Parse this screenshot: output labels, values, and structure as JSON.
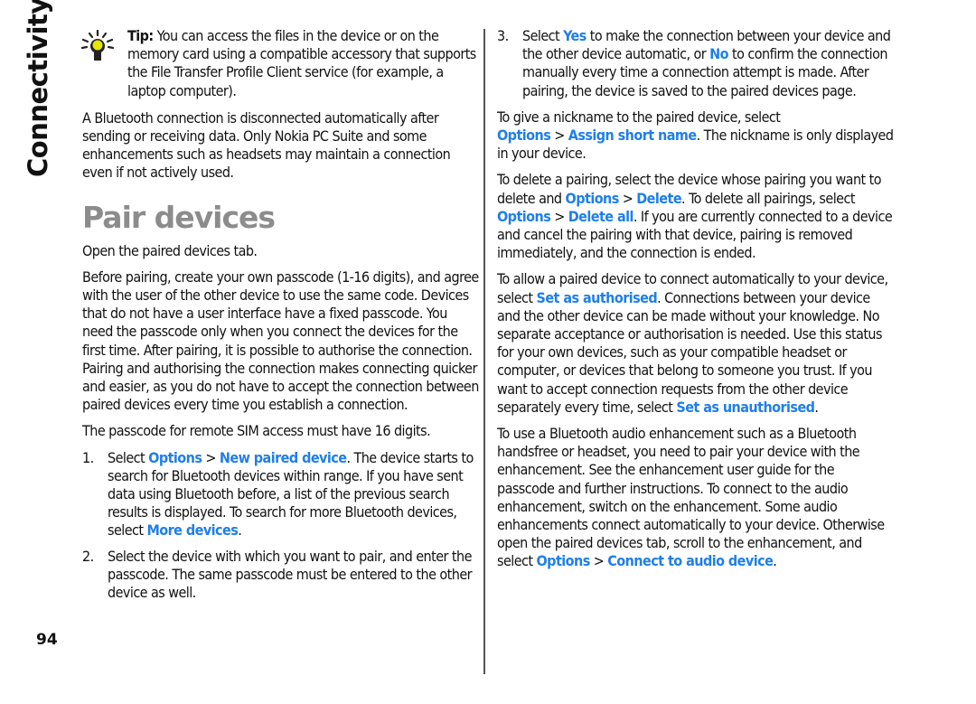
{
  "section_title": "Connectivity",
  "page_number": "94",
  "colors": {
    "link": "#1f7fe8",
    "heading": "#8c8c8c",
    "text": "#111111"
  },
  "left": {
    "tip": {
      "icon": "lightbulb-icon",
      "label": "Tip:",
      "text": " You can access the files in the device or on the memory card using a compatible accessory that supports the File Transfer Profile Client service (for example, a laptop computer)."
    },
    "para_disconnect": "A Bluetooth connection is disconnected automatically after sending or receiving data. Only Nokia PC Suite and some enhancements such as headsets may maintain a connection even if not actively used.",
    "heading": "Pair devices",
    "para_open": "Open the paired devices tab.",
    "para_before": "Before pairing, create your own passcode (1-16 digits), and agree with the user of the other device to use the same code. Devices that do not have a user interface have a fixed passcode. You need the passcode only when you connect the devices for the first time. After pairing, it is possible to authorise the connection. Pairing and authorising the connection makes connecting quicker and easier, as you do not have to accept the connection between paired devices every time you establish a connection.",
    "para_sim": "The passcode for remote SIM access must have 16 digits.",
    "steps": [
      {
        "num": "1.",
        "pre": "Select ",
        "link1": "Options",
        "sep": ">",
        "link2": "New paired device",
        "mid": ". The device starts to search for Bluetooth devices within range. If you have sent data using Bluetooth before, a list of the previous search results is displayed. To search for more Bluetooth devices, select ",
        "link3": "More devices",
        "post": "."
      },
      {
        "num": "2.",
        "text": "Select the device with which you want to pair, and enter the passcode. The same passcode must be entered to the other device as well."
      }
    ]
  },
  "right": {
    "step3": {
      "num": "3.",
      "pre": "Select ",
      "link_yes": "Yes",
      "mid": " to make the connection between your device and the other device automatic, or ",
      "link_no": "No",
      "post": " to confirm the connection manually every time a connection attempt is made. After pairing, the device is saved to the paired devices page."
    },
    "nickname": {
      "pre": "To give a nickname to the paired device, select ",
      "link1": "Options",
      "sep": ">",
      "link2": "Assign short name",
      "post": ". The nickname is only displayed in your device."
    },
    "delete": {
      "pre": "To delete a pairing, select the device whose pairing you want to delete and ",
      "link1": "Options",
      "sep1": ">",
      "link2": "Delete",
      "mid": ". To delete all pairings, select ",
      "link3": "Options",
      "sep2": ">",
      "link4": "Delete all",
      "post": ". If you are currently connected to a device and cancel the pairing with that device, pairing is removed immediately, and the connection is ended."
    },
    "authorise": {
      "pre": "To allow a paired device to connect automatically to your device, select ",
      "link1": "Set as authorised",
      "mid": ". Connections between your device and the other device can be made without your knowledge. No separate acceptance or authorisation is needed. Use this status for your own devices, such as your compatible headset or computer, or devices that belong to someone you trust. If you want to accept connection requests from the other device separately every time, select ",
      "link2": "Set as unauthorised",
      "post": "."
    },
    "audio": {
      "pre": "To use a Bluetooth audio enhancement such as a Bluetooth handsfree or headset, you need to pair your device with the enhancement. See the enhancement user guide for the passcode and further instructions. To connect to the audio enhancement, switch on the enhancement. Some audio enhancements connect automatically to your device. Otherwise open the paired devices tab, scroll to the enhancement, and select ",
      "link1": "Options",
      "sep": ">",
      "link2": "Connect to audio device",
      "post": "."
    }
  }
}
